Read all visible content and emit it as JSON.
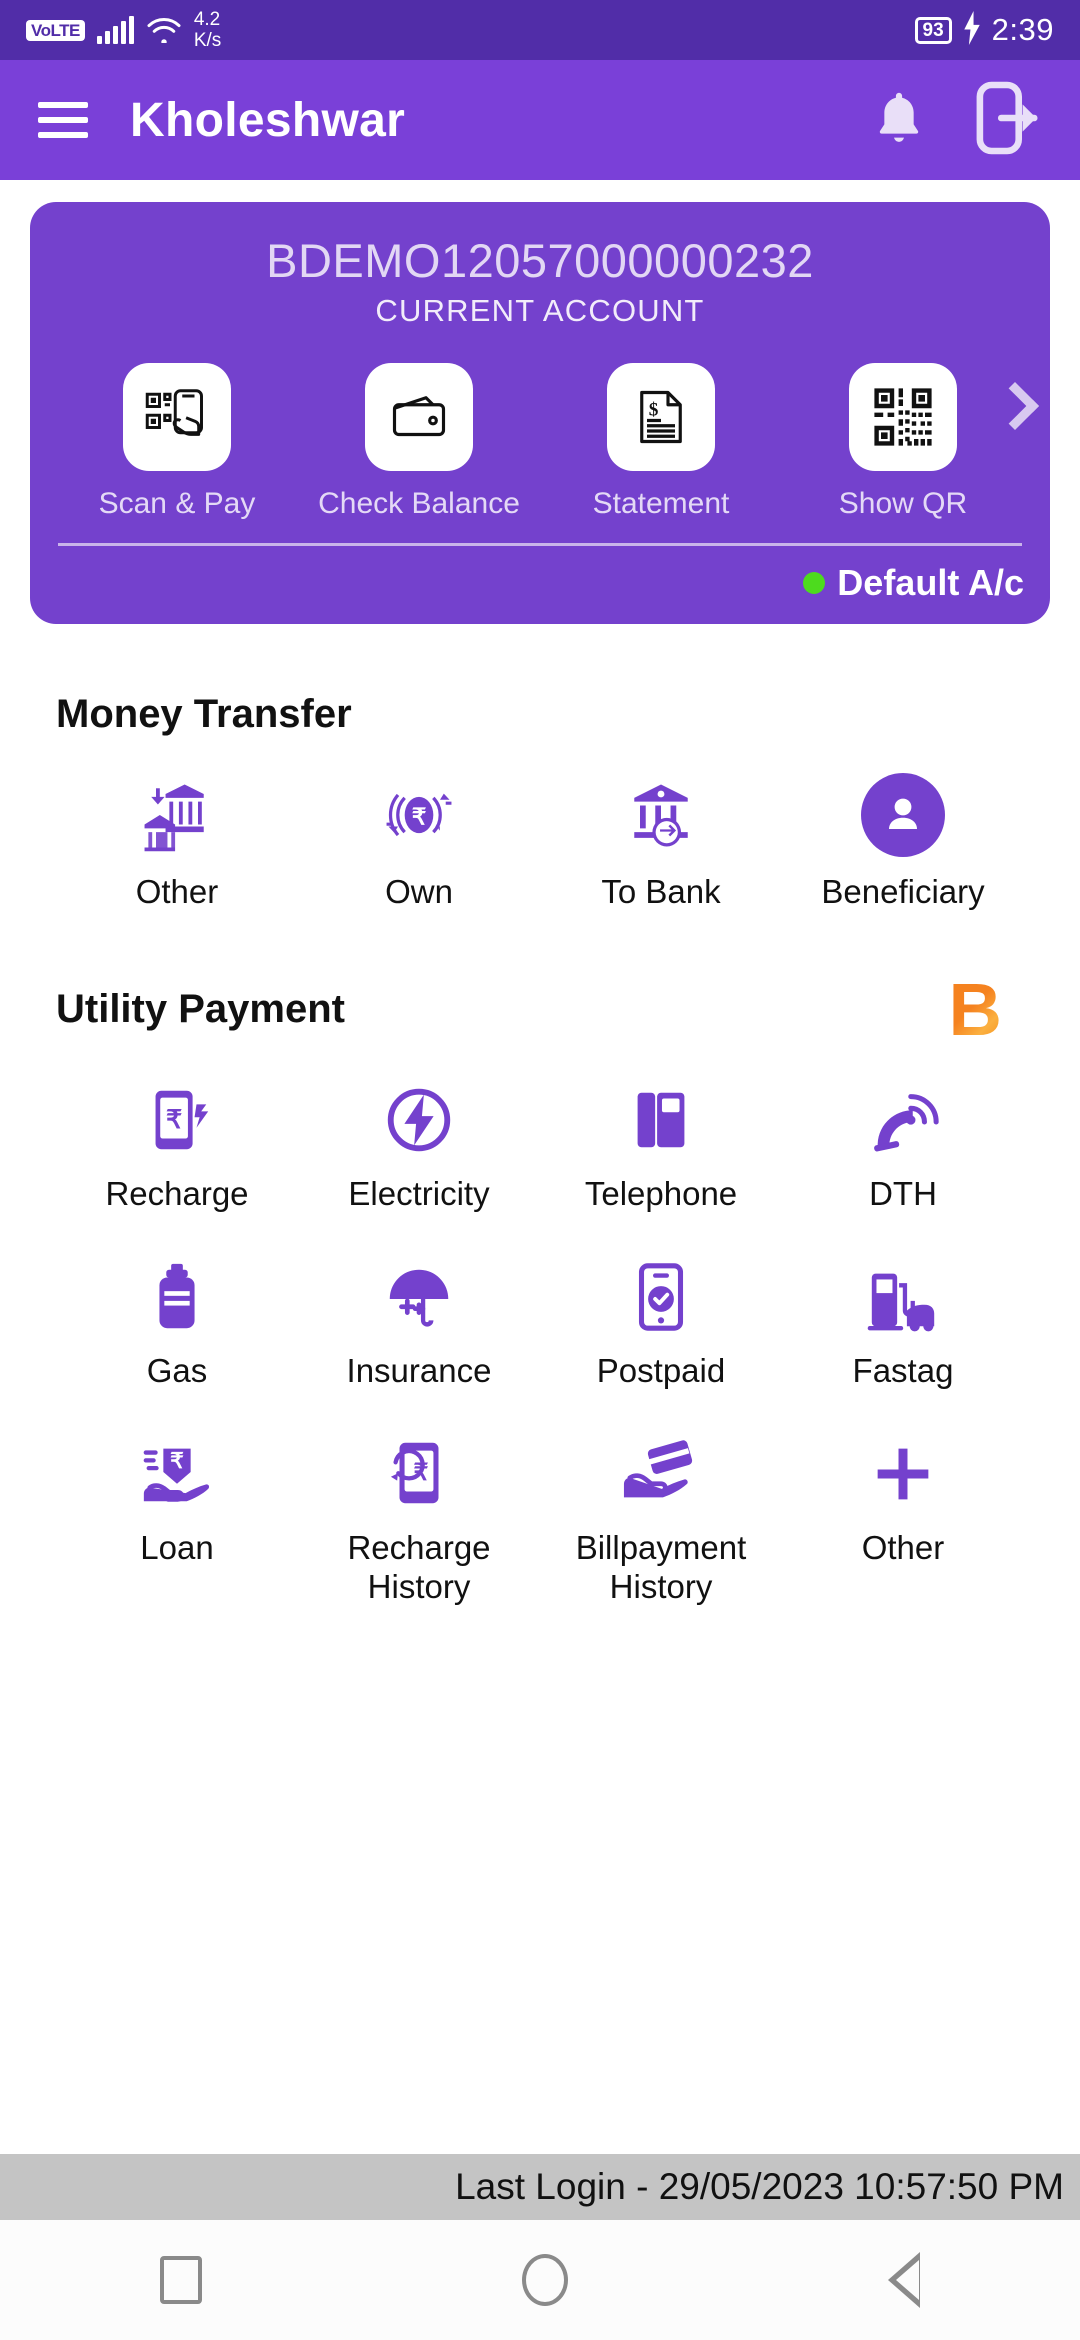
{
  "statusbar": {
    "volte": "VoLTE",
    "net_speed_value": "4.2",
    "net_speed_unit": "K/s",
    "battery": "93",
    "time": "2:39"
  },
  "appbar": {
    "title": "Kholeshwar",
    "menu_icon": "hamburger-menu-icon",
    "bell_icon": "notification-bell-icon",
    "logout_icon": "logout-icon"
  },
  "account_card": {
    "account_number": "BDEMO12057000000232",
    "account_type": "CURRENT ACCOUNT",
    "default_label": "Default A/c",
    "status_dot_color": "#4ddb1e",
    "card_color": "#7441cd",
    "quick_actions": [
      {
        "label": "Scan & Pay",
        "icon": "scan-qr-hand-icon"
      },
      {
        "label": "Check Balance",
        "icon": "wallet-icon"
      },
      {
        "label": "Statement",
        "icon": "document-dollar-icon"
      },
      {
        "label": "Show QR",
        "icon": "qr-code-icon"
      }
    ],
    "next_arrow_icon": "chevron-right-icon"
  },
  "money_transfer": {
    "title": "Money Transfer",
    "items": [
      {
        "label": "Other",
        "icon": "bank-to-home-icon"
      },
      {
        "label": "Own",
        "icon": "rupee-exchange-icon"
      },
      {
        "label": "To Bank",
        "icon": "bank-transfer-icon"
      },
      {
        "label": "Beneficiary",
        "icon": "person-avatar-icon"
      }
    ]
  },
  "utility_payment": {
    "title": "Utility Payment",
    "bbps_logo": "B",
    "items": [
      {
        "label": "Recharge",
        "icon": "mobile-rupee-icon"
      },
      {
        "label": "Electricity",
        "icon": "lightning-bolt-icon"
      },
      {
        "label": "Telephone",
        "icon": "telephone-book-icon"
      },
      {
        "label": "DTH",
        "icon": "satellite-dish-icon"
      },
      {
        "label": "Gas",
        "icon": "gas-cylinder-icon"
      },
      {
        "label": "Insurance",
        "icon": "umbrella-icon"
      },
      {
        "label": "Postpaid",
        "icon": "mobile-checkmark-icon"
      },
      {
        "label": "Fastag",
        "icon": "fuel-pump-car-icon"
      },
      {
        "label": "Loan",
        "icon": "hand-rupee-icon"
      },
      {
        "label": "Recharge History",
        "icon": "mobile-history-icon"
      },
      {
        "label": "Billpayment History",
        "icon": "hand-card-icon"
      },
      {
        "label": "Other",
        "icon": "plus-icon"
      }
    ]
  },
  "footer": {
    "last_login": "Last Login - 29/05/2023 10:57:50 PM"
  },
  "navbar": {
    "recents": "square-recents-icon",
    "home": "circle-home-icon",
    "back": "triangle-back-icon"
  }
}
